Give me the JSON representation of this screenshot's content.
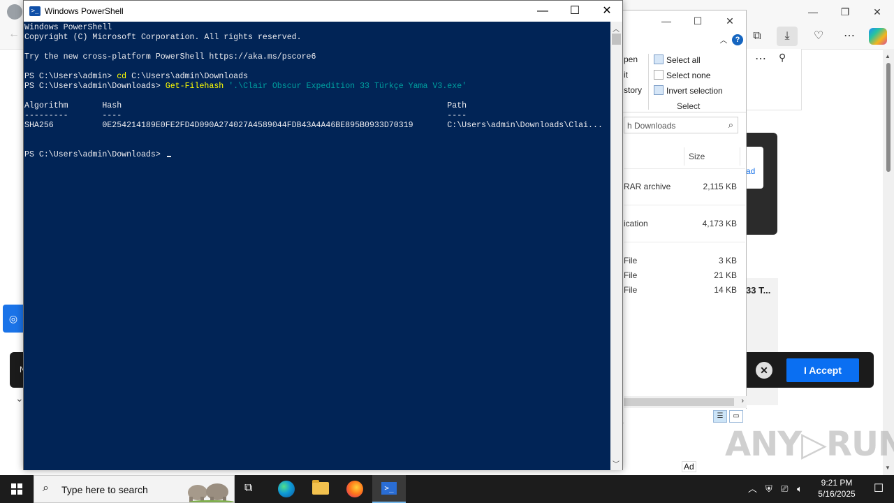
{
  "browser": {
    "min_label": "—",
    "restore_label": "❐",
    "close_label": "✕",
    "more_label": "⋯",
    "ad_button_label": "ad",
    "item_title": "33 T...",
    "accept_label": "I Accept",
    "close_cookie_label": "✕",
    "left_letter": "N",
    "ad_label": "Ad",
    "watermark": "ANY▷RUN"
  },
  "explorer": {
    "ribbon": {
      "open_partial": "pen",
      "edit_partial": "it",
      "history_partial": "story",
      "select_all": "Select all",
      "select_none": "Select none",
      "invert_selection": "Invert selection",
      "group_label": "Select"
    },
    "search_placeholder": "h Downloads",
    "column_size": "Size",
    "rows": [
      {
        "type": "RAR archive",
        "size": "2,115 KB"
      },
      {
        "type": "ication",
        "size": "4,173 KB"
      },
      {
        "type": "File",
        "size": "3 KB"
      },
      {
        "type": "File",
        "size": "21 KB"
      },
      {
        "type": "File",
        "size": "14 KB"
      }
    ]
  },
  "powershell": {
    "title": "Windows PowerShell",
    "lines": {
      "l1": "Windows PowerShell",
      "l2": "Copyright (C) Microsoft Corporation. All rights reserved.",
      "l3": "Try the new cross-platform PowerShell https://aka.ms/pscore6",
      "l4_prompt": "PS C:\\Users\\admin> ",
      "l4_cmd": "cd",
      "l4_arg": " C:\\Users\\admin\\Downloads",
      "l5_prompt": "PS C:\\Users\\admin\\Downloads> ",
      "l5_cmd": "Get-Filehash",
      "l5_str": " '.\\Clair Obscur Expedition 33 Türkçe Yama V3.exe'",
      "hdr": "Algorithm       Hash                                                                   Path",
      "dashes": "---------       ----                                                                   ----",
      "row": "SHA256          0E254214189E0FE2FD4D090A274027A4589044FDB43A4A46BE895B0933D70319       C:\\Users\\admin\\Downloads\\Clai...",
      "prompt_final": "PS C:\\Users\\admin\\Downloads> "
    }
  },
  "taskbar": {
    "search_placeholder": "Type here to search",
    "time": "9:21 PM",
    "date": "5/16/2025"
  }
}
